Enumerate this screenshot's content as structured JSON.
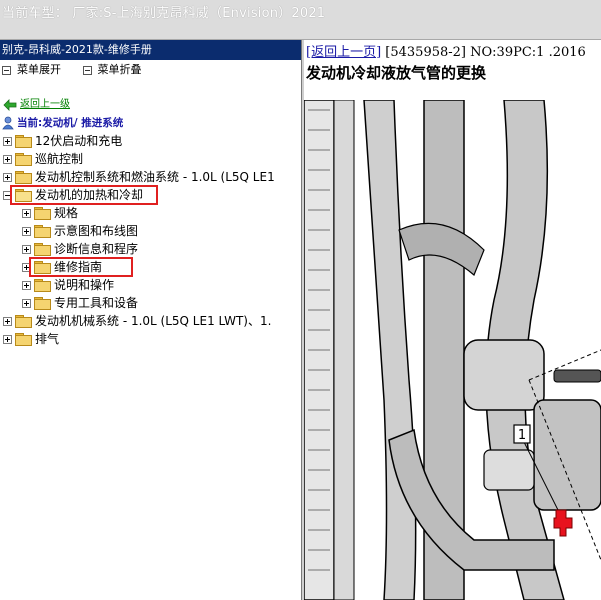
{
  "titlebar": {
    "text": "当前车型： 厂家:S-上海别克昂科威（Envision）2021"
  },
  "left_panel": {
    "header": "别克-昂科威-2021款-维修手册",
    "toolbar": {
      "expand": "菜单展开",
      "collapse": "菜单折叠"
    },
    "back_link": "返回上一级",
    "current_label": "当前:发动机/ 推进系统",
    "tree": [
      {
        "label": "12伏启动和充电",
        "level": 0,
        "expanded": false
      },
      {
        "label": "巡航控制",
        "level": 0,
        "expanded": false
      },
      {
        "label": "发动机控制系统和燃油系统 - 1.0L (L5Q LE1",
        "level": 0,
        "expanded": false
      },
      {
        "label": "发动机的加热和冷却",
        "level": 0,
        "expanded": true,
        "highlighted": true
      },
      {
        "label": "规格",
        "level": 1,
        "expanded": false
      },
      {
        "label": "示意图和布线图",
        "level": 1,
        "expanded": false
      },
      {
        "label": "诊断信息和程序",
        "level": 1,
        "expanded": false
      },
      {
        "label": "维修指南",
        "level": 1,
        "expanded": false,
        "highlighted": true
      },
      {
        "label": "说明和操作",
        "level": 1,
        "expanded": false
      },
      {
        "label": "专用工具和设备",
        "level": 1,
        "expanded": false
      },
      {
        "label": "发动机机械系统 - 1.0L (L5Q LE1 LWT)、1.",
        "level": 0,
        "expanded": false
      },
      {
        "label": "排气",
        "level": 0,
        "expanded": false
      }
    ]
  },
  "right_panel": {
    "back_link": "[返回上一页]",
    "doc_ref": "[5435958-2] NO:39PC:1 .2016",
    "title": "发动机冷却液放气管的更换",
    "callout": "1"
  },
  "colors": {
    "header_bg": "#0b2c6e",
    "highlight": "#e02020",
    "link": "#1a1aa6",
    "back_link": "#008000"
  }
}
